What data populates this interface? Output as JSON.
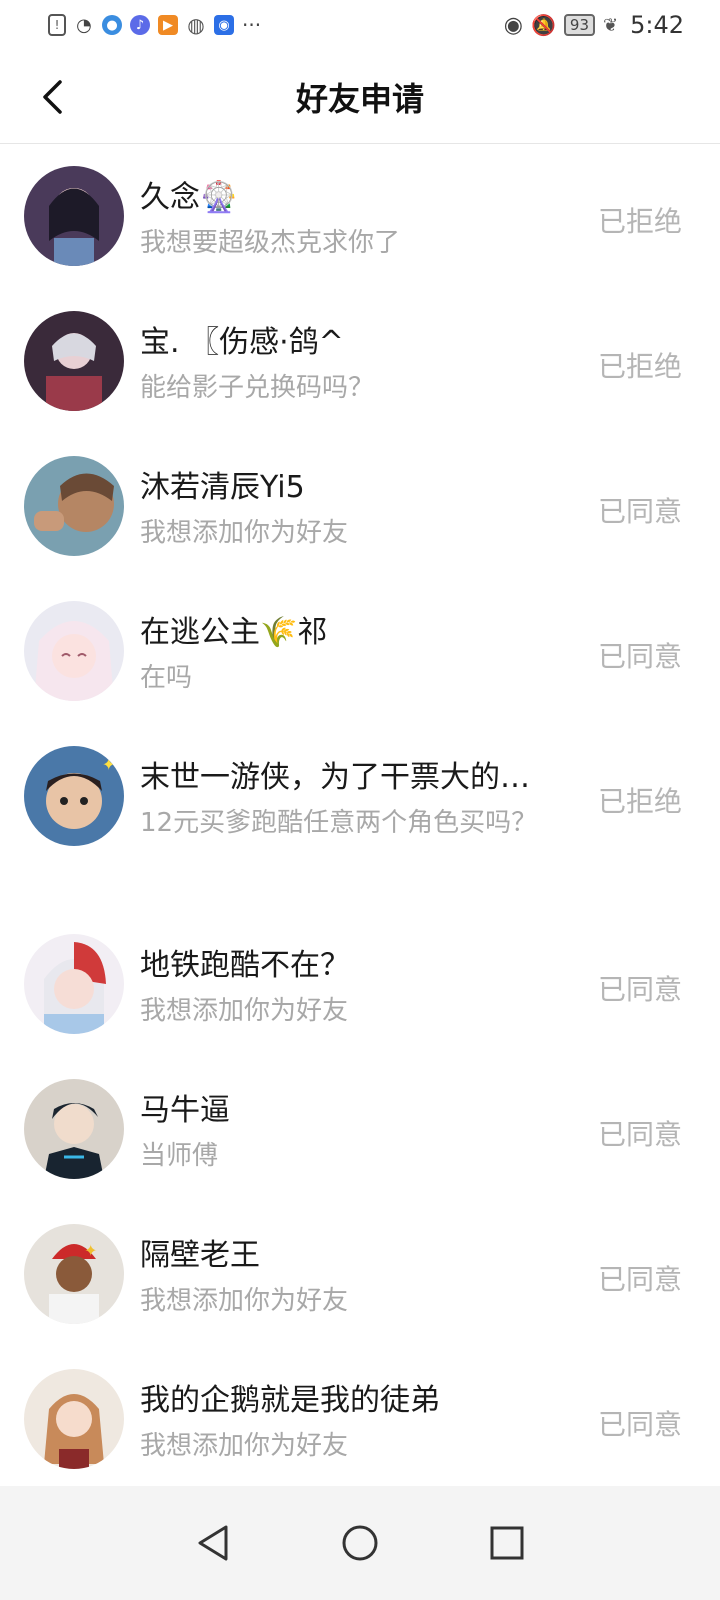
{
  "status_bar": {
    "time": "5:42",
    "battery": "93",
    "icons": [
      "alert-icon",
      "wifi-icon",
      "browser-icon",
      "music-icon",
      "video-icon",
      "wechat-icon",
      "bulb-icon",
      "more-icon",
      "eye-icon",
      "mute-icon",
      "battery-icon",
      "leaf-icon"
    ],
    "more": "···"
  },
  "header": {
    "title": "好友申请",
    "back_icon": "back-arrow-icon"
  },
  "requests": [
    {
      "name": "久念🎡",
      "message": "我想要超级杰克求你了",
      "status": "已拒绝",
      "avatar_color": "#4a3a5a"
    },
    {
      "name": "宝. 〖伤感·鸽^",
      "message": "能给影子兑换码吗？",
      "status": "已拒绝",
      "avatar_color": "#5a3b4a"
    },
    {
      "name": "沐若清辰Yi5",
      "message": "我想添加你为好友",
      "status": "已同意",
      "avatar_color": "#8a6a52"
    },
    {
      "name": "在逃公主🌾祁",
      "message": "在吗",
      "status": "已同意",
      "avatar_color": "#e9c9d3"
    },
    {
      "name": "末世一游侠，为了干票大的…",
      "message": "12元买爹跑酷任意两个角色买吗？",
      "status": "已拒绝",
      "avatar_color": "#6b9ab8"
    },
    {
      "name": "地铁跑酷不在？",
      "message": "我想添加你为好友",
      "status": "已同意",
      "avatar_color": "#d9b9c7"
    },
    {
      "name": "马牛逼",
      "message": "当师傅",
      "status": "已同意",
      "avatar_color": "#c8c2b8"
    },
    {
      "name": "隔壁老王",
      "message": "我想添加你为好友",
      "status": "已同意",
      "avatar_color": "#b28a6a"
    },
    {
      "name": "我的企鹅就是我的徒弟",
      "message": "我想添加你为好友",
      "status": "已同意",
      "avatar_color": "#d8b08a"
    }
  ],
  "nav_bar": {
    "icons": [
      "back-triangle-icon",
      "home-circle-icon",
      "recents-square-icon"
    ]
  }
}
